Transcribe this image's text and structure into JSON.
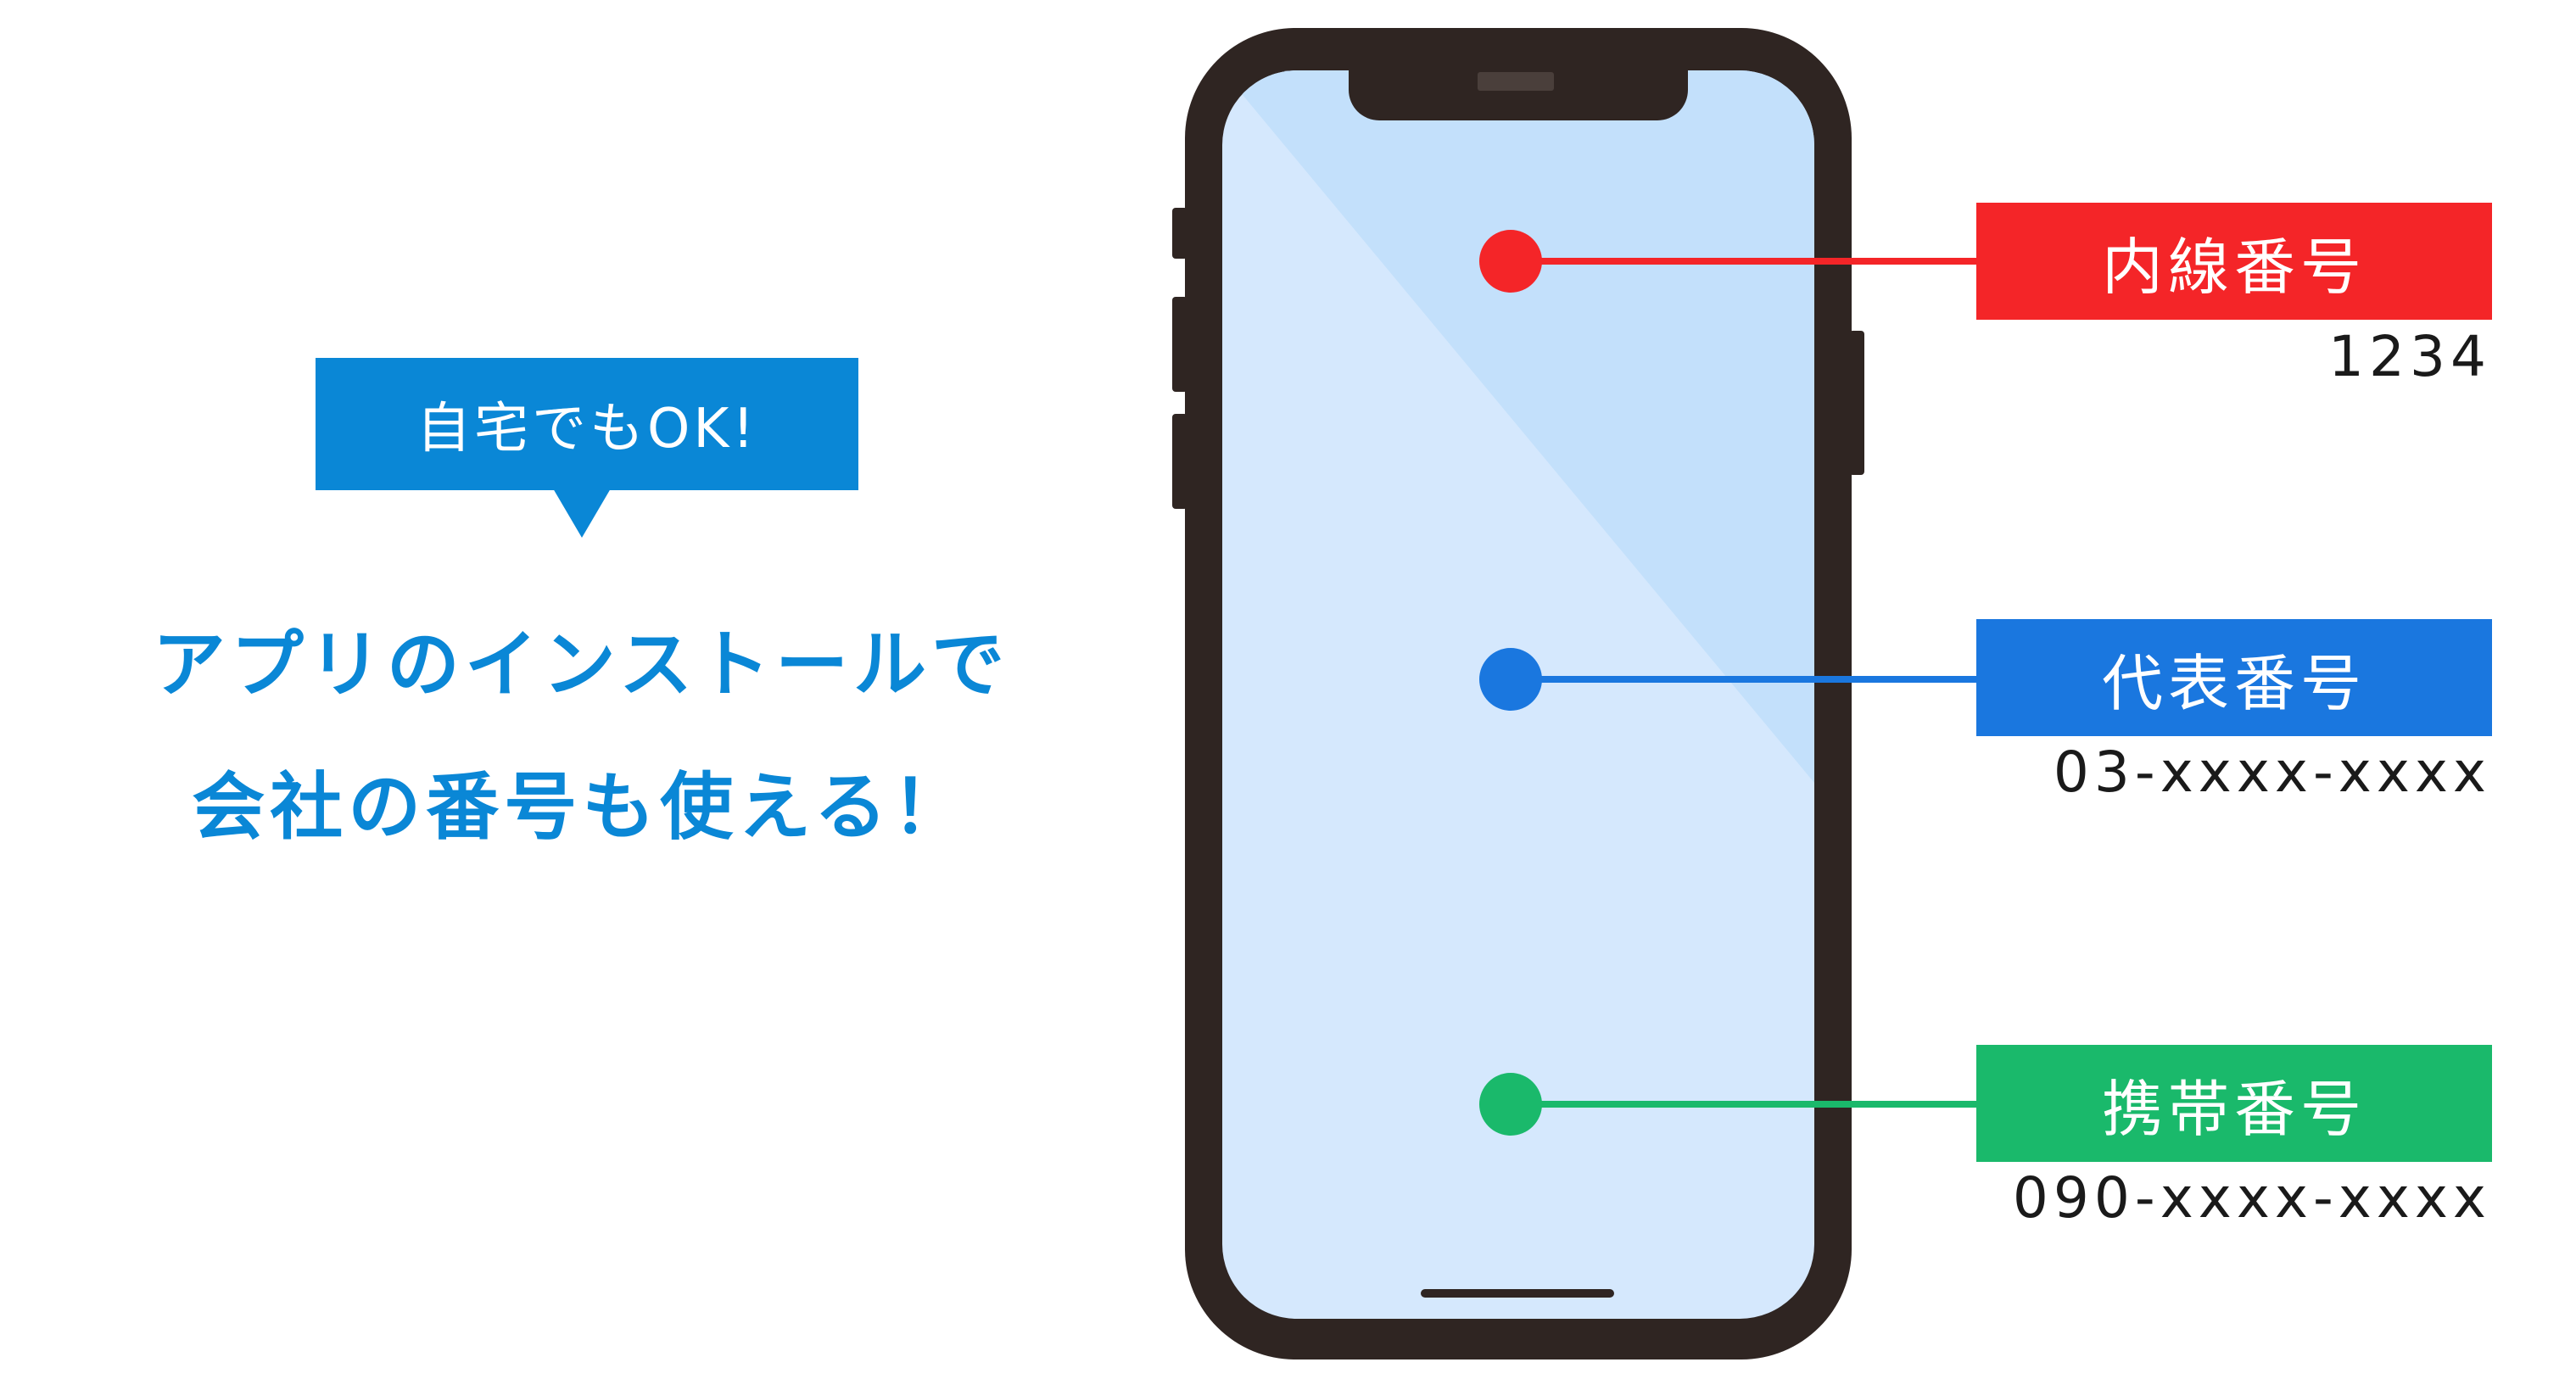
{
  "bubble": {
    "text": "自宅でもOK!",
    "color": "#0a87d6"
  },
  "headline": {
    "line1": "アプリのインストールで",
    "line2": "会社の番号も使える！",
    "color": "#0a87d6"
  },
  "phone": {
    "body_color": "#2f2522",
    "screen_color": "#d5e8fd",
    "screen_highlight_color": "#c3e0fb"
  },
  "numbers": [
    {
      "label": "内線番号",
      "value": "1234",
      "color": "#f42528"
    },
    {
      "label": "代表番号",
      "value": "03-xxxx-xxxx",
      "color": "#1a77df"
    },
    {
      "label": "携帯番号",
      "value": "090-xxxx-xxxx",
      "color": "#1ab96b"
    }
  ]
}
